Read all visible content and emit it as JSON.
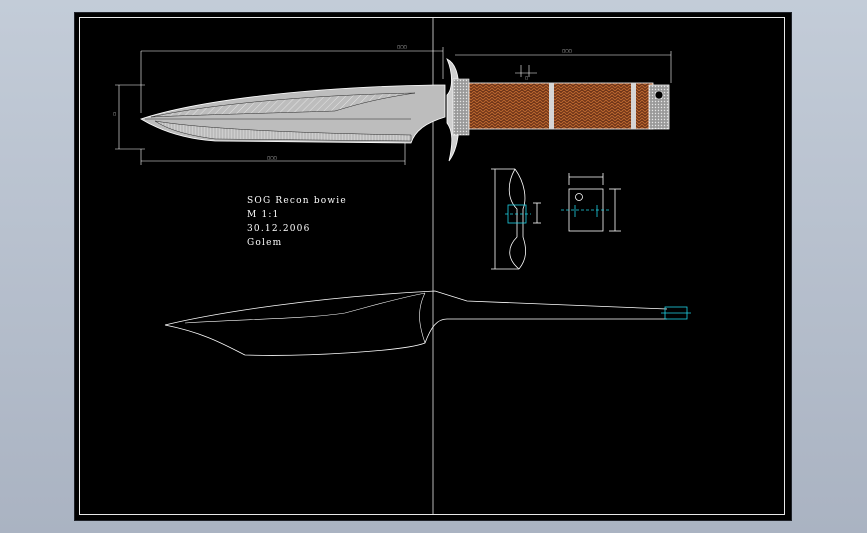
{
  "drawing": {
    "title_block": {
      "line1": "SOG Recon bowie",
      "line2": "M 1:1",
      "line3": "30.12.2006",
      "line4": "Golem"
    },
    "dimensions": {
      "overall_length": "",
      "handle_length": "",
      "blade_length": "",
      "blade_height": ""
    },
    "colors": {
      "background": "#000000",
      "lines": "#ffffff",
      "blade_fill": "#bdbdbd",
      "handle_leather": "#7a3c1e",
      "guard_fill": "#cfcfcf",
      "cyan_detail": "#1fd3e6"
    }
  }
}
